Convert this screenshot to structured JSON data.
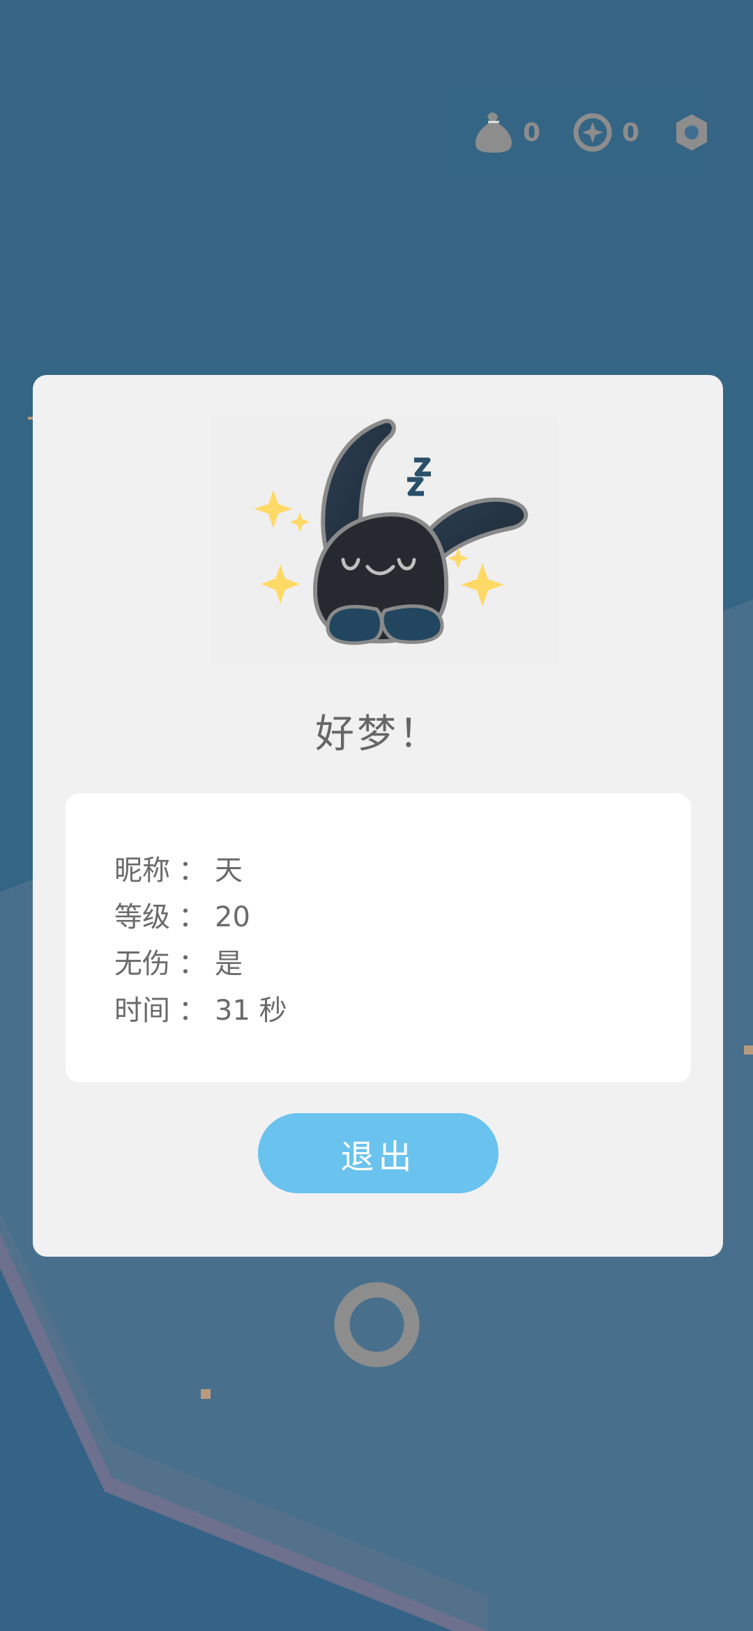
{
  "hud": {
    "bag_icon": "money-bag-icon",
    "bag_count": "0",
    "token_icon": "star-coin-icon",
    "token_count": "0",
    "settings_icon": "hexagon-settings-icon"
  },
  "dialog": {
    "mascot": "sleeping-black-bunny-with-sparkles",
    "title": "好梦！",
    "stats": [
      {
        "label": "昵称",
        "sep": "：",
        "value": "天"
      },
      {
        "label": "等级",
        "sep": "：",
        "value": "20"
      },
      {
        "label": "无伤",
        "sep": "：",
        "value": "是"
      },
      {
        "label": "时间",
        "sep": "：",
        "value": "31 秒"
      }
    ],
    "exit_label": "退出"
  },
  "colors": {
    "background": "#276183",
    "card": "#f1f1f1",
    "stats_box": "#ffffff",
    "button": "#6ac2ee",
    "text": "#6a6a6a"
  }
}
